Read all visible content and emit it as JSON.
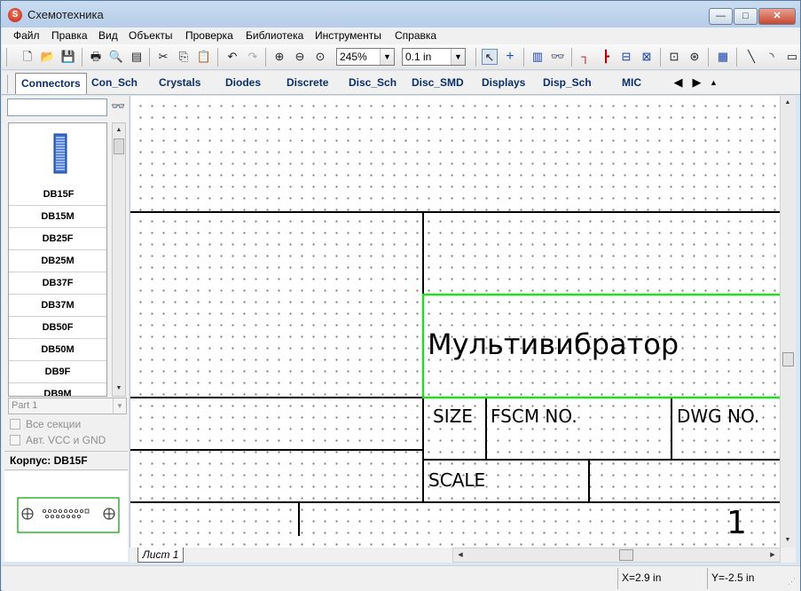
{
  "window": {
    "title": "Схемотехника",
    "controls": {
      "minimize": "—",
      "maximize": "□",
      "close": "✕"
    }
  },
  "menu": [
    "Файл",
    "Правка",
    "Вид",
    "Объекты",
    "Проверка",
    "Библиотека",
    "Инструменты",
    "Справка"
  ],
  "toolbar": {
    "zoom_value": "245%",
    "grid_value": "0.1 in"
  },
  "library_tabs": [
    "Connectors",
    "Con_Sch",
    "Crystals",
    "Diodes",
    "Discrete",
    "Disc_Sch",
    "Disc_SMD",
    "Displays",
    "Disp_Sch",
    "MIC"
  ],
  "active_library_tab": "Connectors",
  "library": {
    "search_value": "",
    "parts": [
      "DB15F",
      "DB15M",
      "DB25F",
      "DB25M",
      "DB37F",
      "DB37M",
      "DB50F",
      "DB50M",
      "DB9F",
      "DB9M"
    ],
    "part_select": "Part 1",
    "all_sections_label": "Все секции",
    "auto_vcc_label": "Авт. VCC и GND",
    "package_label": "Корпус: DB15F"
  },
  "schematic": {
    "title": "Мультивибратор",
    "size_label": "SIZE",
    "fscm_label": "FSCM NO.",
    "dwg_label": "DWG NO.",
    "scale_label": "SCALE",
    "sheet_number": "1"
  },
  "sheet_tab": "Лист 1",
  "status": {
    "x": "X=2.9 in",
    "y": "Y=-2.5 in"
  }
}
